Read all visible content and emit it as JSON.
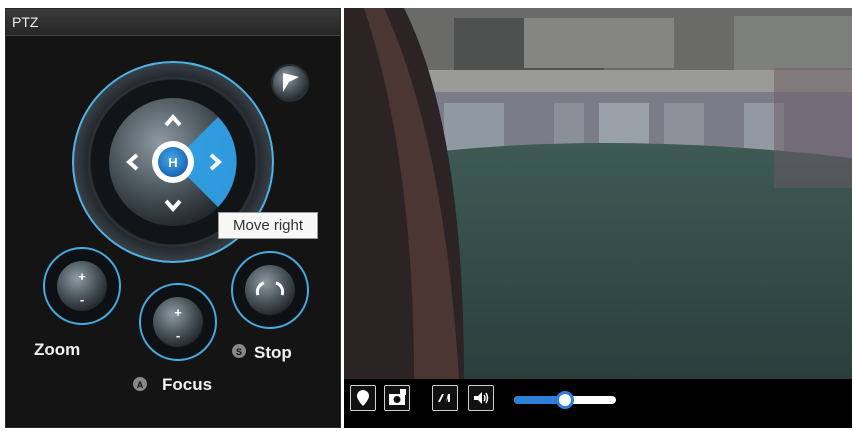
{
  "panel": {
    "title": "PTZ",
    "home_label": "H",
    "tooltip": "Move right",
    "zoom_label": "Zoom",
    "focus_label": "Focus",
    "stop_label": "Stop",
    "focus_key": "A",
    "stop_key": "S"
  },
  "video": {
    "volume_level": 0.5,
    "toolbar_icons": [
      "marker-icon",
      "snapshot-icon",
      "aspect-icon",
      "volume-icon"
    ],
    "accent_color": "#2f7fd6"
  }
}
